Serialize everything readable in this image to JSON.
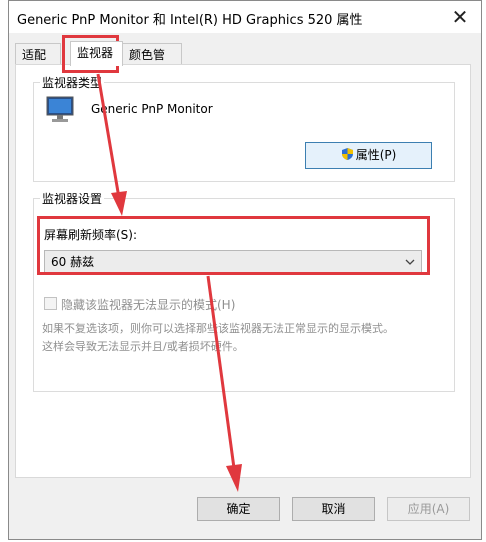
{
  "window": {
    "title": "Generic PnP Monitor 和 Intel(R) HD Graphics 520 属性",
    "close_glyph": "✕"
  },
  "tabs": [
    {
      "label": "适配器",
      "active": false
    },
    {
      "label": "监视器",
      "active": true
    },
    {
      "label": "颜色管理",
      "active": false
    }
  ],
  "monitor_type": {
    "group_label": "监视器类型",
    "name": "Generic PnP Monitor",
    "properties_button": "属性(P)",
    "icons": [
      "monitor-icon",
      "shield-icon"
    ]
  },
  "monitor_settings": {
    "group_label": "监视器设置",
    "refresh_label": "屏幕刷新频率(S):",
    "refresh_value": "60 赫兹",
    "hide_modes_label": "隐藏该监视器无法显示的模式(H)",
    "hide_modes_checked": false,
    "hint_line1": "如果不复选该项，则你可以选择那些该监视器无法正常显示的显示模式。",
    "hint_line2": "这样会导致无法显示并且/或者损坏硬件。"
  },
  "buttons": {
    "ok": "确定",
    "cancel": "取消",
    "apply": "应用(A)"
  },
  "annotations": {
    "highlight_color": "#e0383e"
  }
}
